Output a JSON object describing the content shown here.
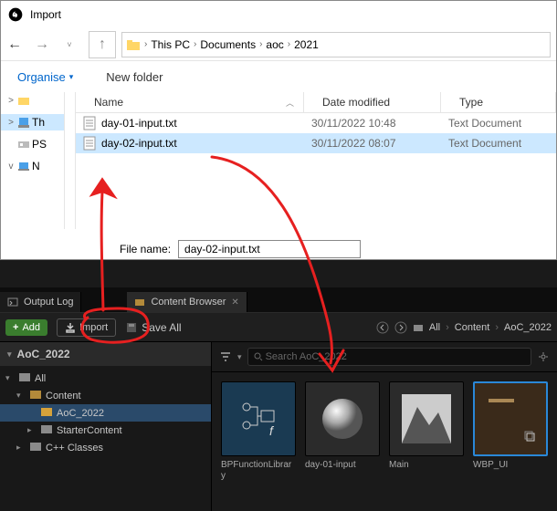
{
  "dialog": {
    "title": "Import",
    "breadcrumbs": [
      "This PC",
      "Documents",
      "aoc",
      "2021"
    ],
    "organise": "Organise",
    "newfolder": "New folder",
    "columns": {
      "name": "Name",
      "date": "Date modified",
      "type": "Type"
    },
    "files": [
      {
        "name": "day-01-input.txt",
        "date": "30/11/2022 10:48",
        "type": "Text Document",
        "selected": false
      },
      {
        "name": "day-02-input.txt",
        "date": "30/11/2022 08:07",
        "type": "Text Document",
        "selected": true
      }
    ],
    "tree": [
      {
        "label": "",
        "kind": "folder-open",
        "chev": ">"
      },
      {
        "label": "Th",
        "kind": "pc",
        "chev": ">",
        "sel": true
      },
      {
        "label": "PS",
        "kind": "drive",
        "chev": " "
      },
      {
        "label": "N",
        "kind": "net",
        "chev": "v"
      }
    ],
    "filename_label": "File name:",
    "filename_value": "day-02-input.txt"
  },
  "ue": {
    "tabs": [
      {
        "label": "Output Log",
        "active": false,
        "icon": "log"
      },
      {
        "label": "Content Browser",
        "active": true,
        "icon": "folder",
        "closable": true
      }
    ],
    "add": "Add",
    "import": "Import",
    "saveall": "Save All",
    "path_all": "All",
    "path": [
      "Content",
      "AoC_2022"
    ],
    "side_header": "AoC_2022",
    "side_tree": [
      {
        "label": "All",
        "depth": 0,
        "chev": "▾",
        "color": "#8a8a8a"
      },
      {
        "label": "Content",
        "depth": 1,
        "chev": "▾",
        "color": "#b38a3a"
      },
      {
        "label": "AoC_2022",
        "depth": 2,
        "chev": " ",
        "color": "#d6a23a",
        "sel": true
      },
      {
        "label": "StarterContent",
        "depth": 2,
        "chev": "▸",
        "color": "#8a8a8a"
      },
      {
        "label": "C++ Classes",
        "depth": 1,
        "chev": "▸",
        "color": "#8a8a8a"
      }
    ],
    "search_placeholder": "Search AoC_2022",
    "assets": [
      {
        "label": "BPFunctionLibrary",
        "kind": "bp"
      },
      {
        "label": "day-01-input",
        "kind": "sphere"
      },
      {
        "label": "Main",
        "kind": "level"
      },
      {
        "label": "WBP_UI",
        "kind": "widget",
        "sel": true
      }
    ]
  }
}
